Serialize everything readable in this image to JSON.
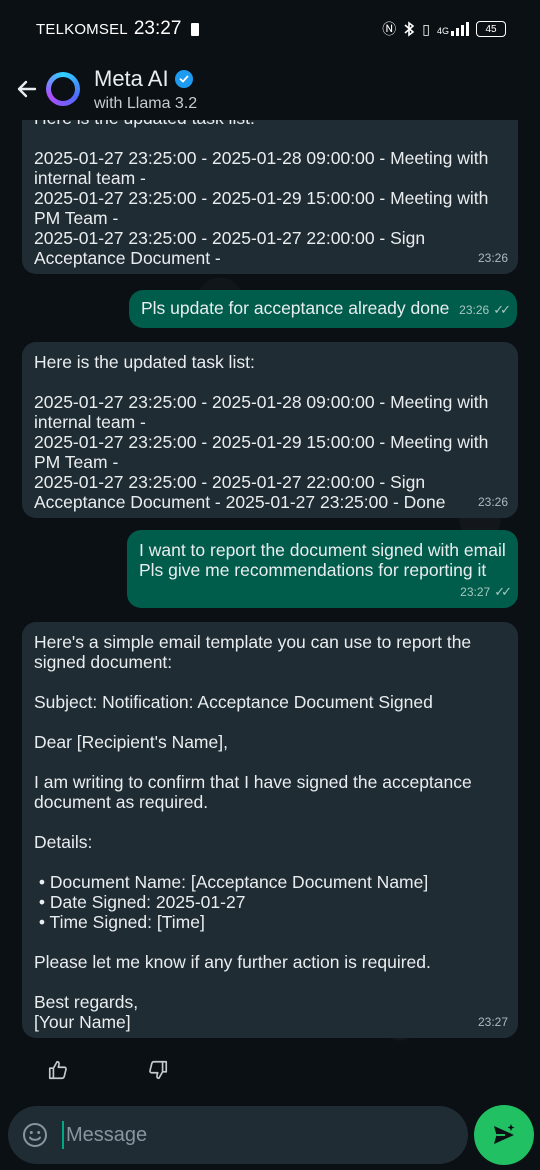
{
  "status_bar": {
    "carrier": "TELKOMSEL",
    "time": "23:27",
    "network": "4G",
    "battery": "45"
  },
  "header": {
    "contact_name": "Meta AI",
    "subtitle": "with Llama 3.2"
  },
  "messages": [
    {
      "direction": "incoming",
      "partial_top": "Here is the updated task list:",
      "text": "2025-01-27 23:25:00 - 2025-01-28 09:00:00 - Meeting with internal team -\n2025-01-27 23:25:00 - 2025-01-29 15:00:00 - Meeting with PM Team -\n2025-01-27 23:25:00 - 2025-01-27 22:00:00 - Sign Acceptance Document -",
      "time": "23:26"
    },
    {
      "direction": "outgoing",
      "text": "Pls update for acceptance already done",
      "time": "23:26"
    },
    {
      "direction": "incoming",
      "text": "Here is the updated task list:\n\n2025-01-27 23:25:00 - 2025-01-28 09:00:00 - Meeting with internal team -\n2025-01-27 23:25:00 - 2025-01-29 15:00:00 - Meeting with PM Team -\n2025-01-27 23:25:00 - 2025-01-27 22:00:00 - Sign Acceptance Document - 2025-01-27 23:25:00 - Done",
      "time": "23:26"
    },
    {
      "direction": "outgoing",
      "text": "I want to report the document signed with email\nPls give me recommendations for reporting it",
      "time": "23:27"
    },
    {
      "direction": "incoming",
      "text": "Here's a simple email template you can use to report the signed document:\n\nSubject: Notification: Acceptance Document Signed\n\nDear [Recipient's Name],\n\nI am writing to confirm that I have signed the acceptance document as required.\n\nDetails:\n\n • Document Name: [Acceptance Document Name]\n • Date Signed: 2025-01-27\n • Time Signed: [Time]\n\nPlease let me know if any further action is required.\n\nBest regards,\n[Your Name]",
      "time": "23:27"
    }
  ],
  "composer": {
    "placeholder": "Message"
  },
  "colors": {
    "background": "#0b1014",
    "incoming_bubble": "#202c33",
    "outgoing_bubble": "#005c4b",
    "send_button": "#21c063",
    "verified": "#1d9bf0"
  },
  "icons": [
    "back-arrow-icon",
    "verified-badge-icon",
    "thumbs-up-icon",
    "thumbs-down-icon",
    "emoji-icon",
    "send-icon"
  ]
}
